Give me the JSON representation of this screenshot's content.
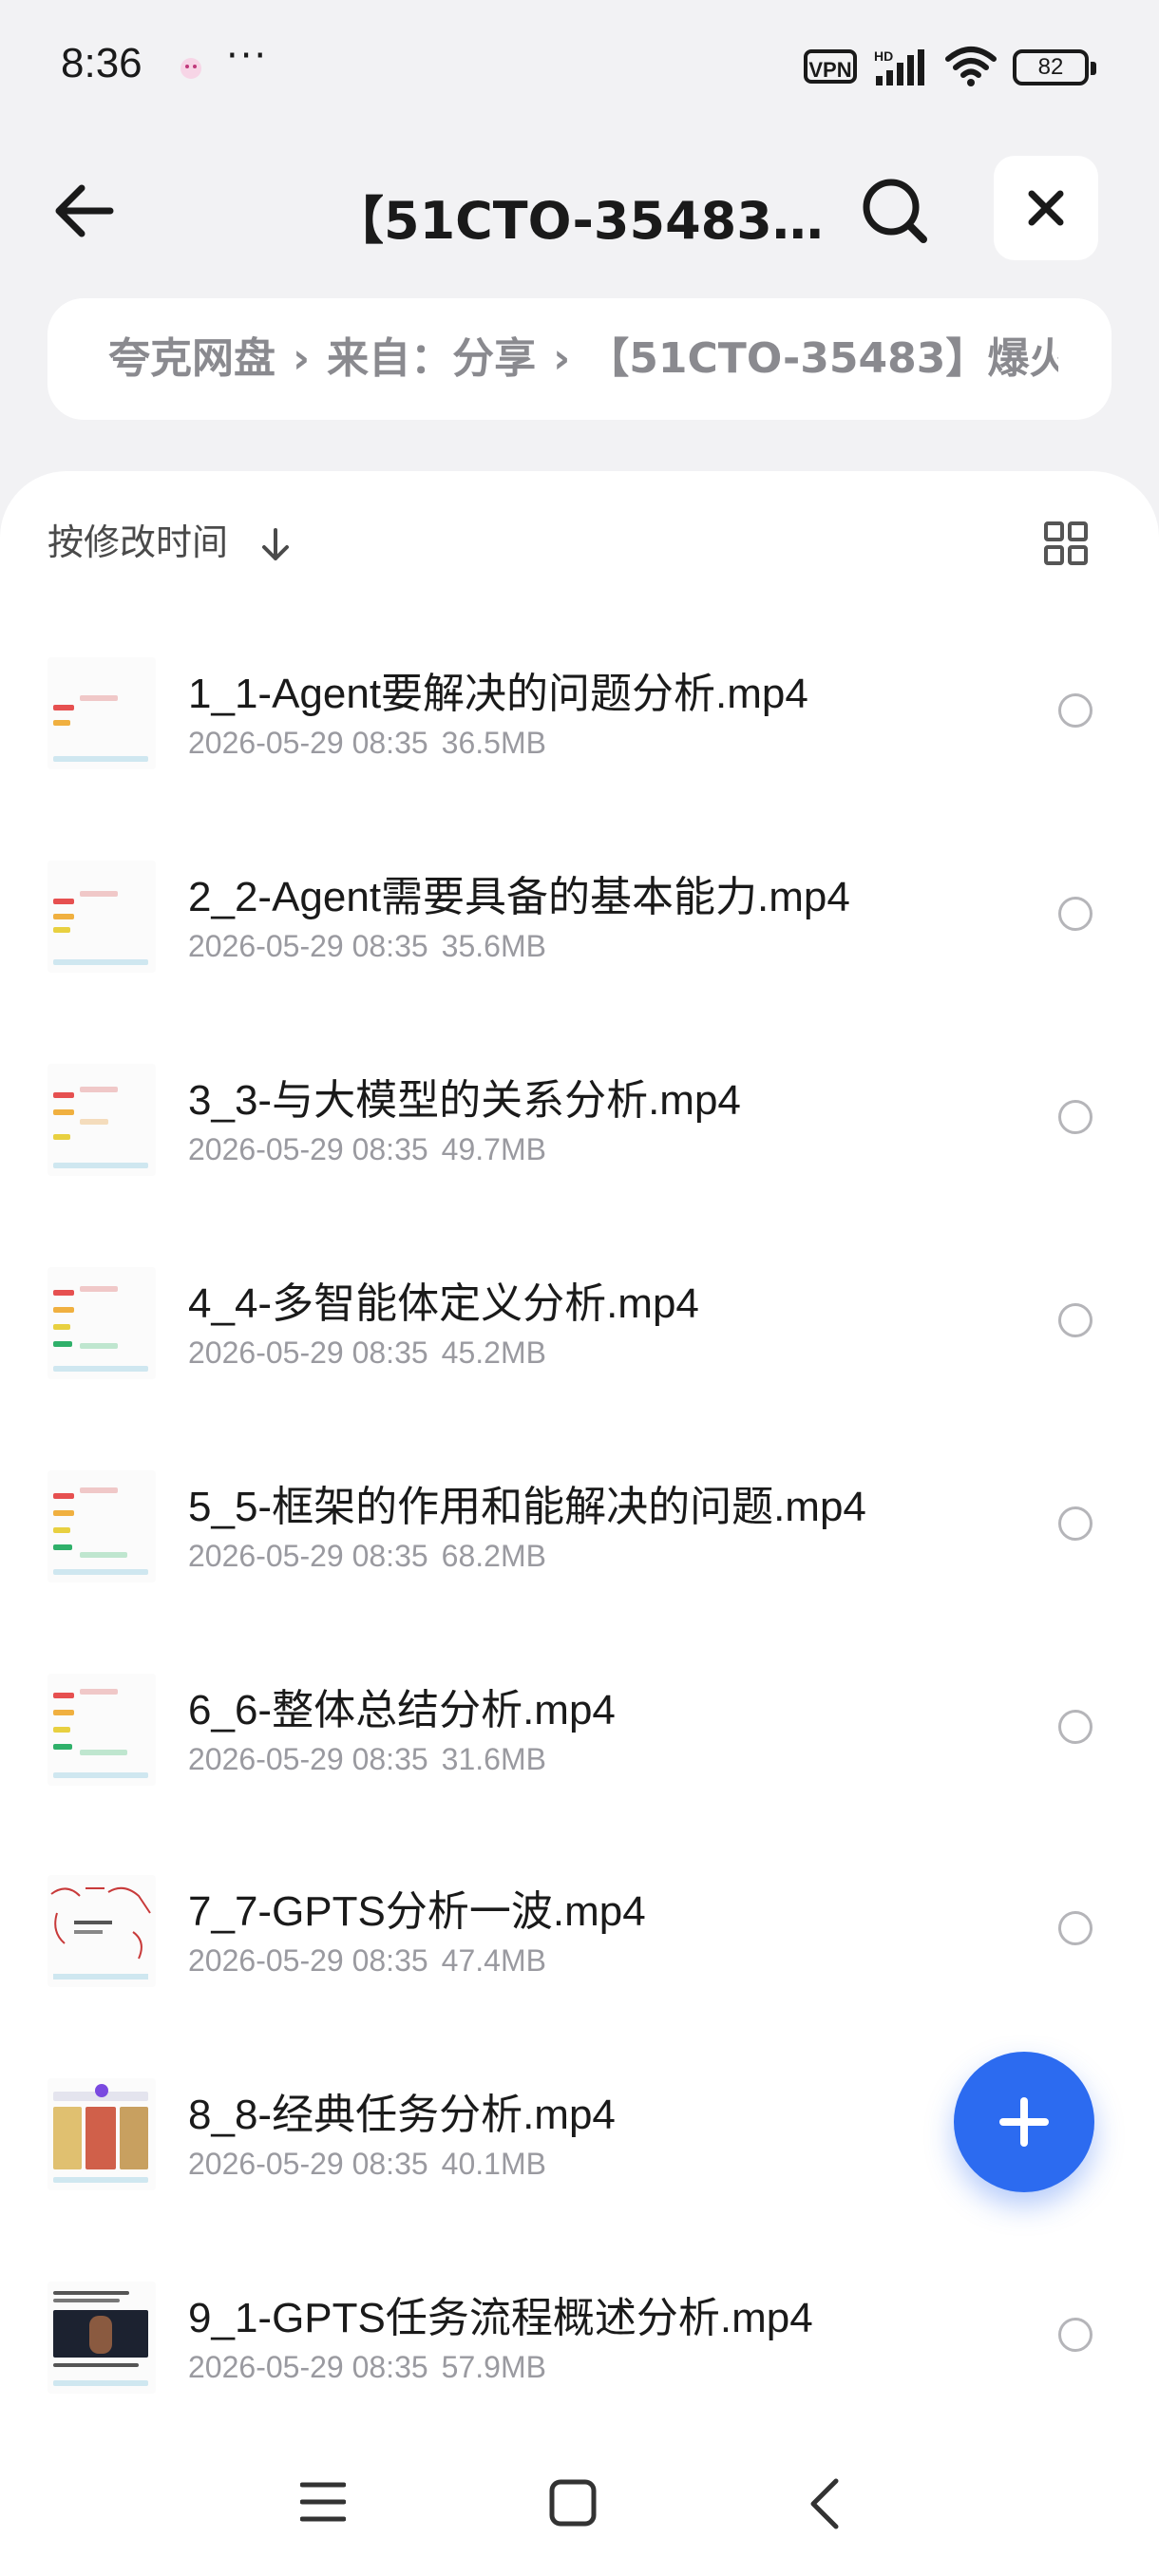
{
  "status_bar": {
    "time": "8:36",
    "dots": "···",
    "vpn": "VPN",
    "network": "HD",
    "battery": "82"
  },
  "header": {
    "title": "【51CTO-35483】..."
  },
  "breadcrumb": {
    "root": "夸克网盘",
    "source": "来自：分享",
    "folder": "【51CTO-35483】爆火"
  },
  "sort": {
    "label": "按修改时间"
  },
  "files": [
    {
      "name": "1_1-Agent要解决的问题分析.mp4",
      "date": "2026-05-29 08:35",
      "size": "36.5MB"
    },
    {
      "name": "2_2-Agent需要具备的基本能力.mp4",
      "date": "2026-05-29 08:35",
      "size": "35.6MB"
    },
    {
      "name": "3_3-与大模型的关系分析.mp4",
      "date": "2026-05-29 08:35",
      "size": "49.7MB"
    },
    {
      "name": "4_4-多智能体定义分析.mp4",
      "date": "2026-05-29 08:35",
      "size": "45.2MB"
    },
    {
      "name": "5_5-框架的作用和能解决的问题.mp4",
      "date": "2026-05-29 08:35",
      "size": "68.2MB"
    },
    {
      "name": "6_6-整体总结分析.mp4",
      "date": "2026-05-29 08:35",
      "size": "31.6MB"
    },
    {
      "name": "7_7-GPTS分析一波.mp4",
      "date": "2026-05-29 08:35",
      "size": "47.4MB"
    },
    {
      "name": "8_8-经典任务分析.mp4",
      "date": "2026-05-29 08:35",
      "size": "40.1MB"
    },
    {
      "name": "9_1-GPTS任务流程概述分析.mp4",
      "date": "2026-05-29 08:35",
      "size": "57.9MB"
    }
  ],
  "colors": {
    "accent": "#2c6bf0",
    "background": "#f2f2f4",
    "meta_text": "#9a9aa0"
  }
}
